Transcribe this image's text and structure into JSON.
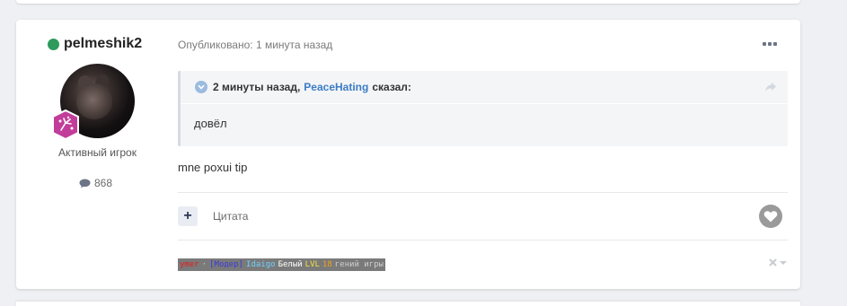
{
  "author": {
    "name": "pelmeshik2",
    "online": true,
    "rank_title": "Активный игрок",
    "post_count": "868"
  },
  "post": {
    "published": "Опубликовано: 1 минута назад",
    "body": "mne poxui tip"
  },
  "quote": {
    "time": "2 минуты назад,",
    "author": "PeaceHating",
    "said": "сказал:",
    "body": "довёл"
  },
  "actions": {
    "quote_label": "Цитата",
    "plus_label": "+"
  },
  "signature": {
    "segments": [
      "ymer",
      "·",
      "[Модер]",
      "Idaigo",
      "Белый",
      "LVL",
      "18",
      "гений игры"
    ]
  },
  "colors": {
    "online": "#2e9a5b",
    "link": "#3c7cc6",
    "rank_badge": "#c23d9a"
  },
  "icons": {
    "options": "ellipsis-icon",
    "like": "heart-icon",
    "share": "share-arrow-icon",
    "report": "close-icon"
  }
}
